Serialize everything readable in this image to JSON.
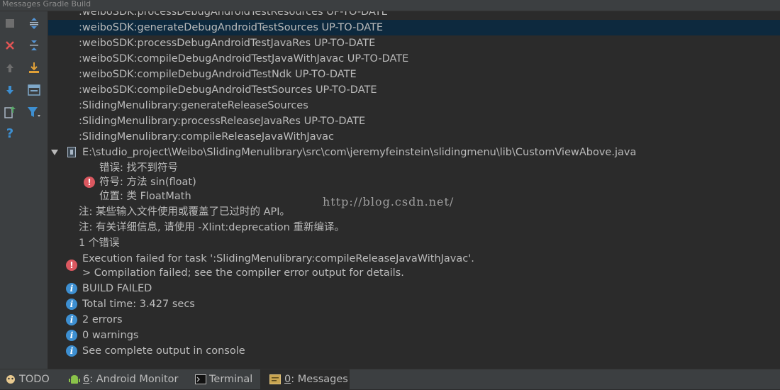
{
  "window": {
    "title": "Messages Gradle Build"
  },
  "toolbar": {
    "buttons": [
      {
        "name": "stop-icon"
      },
      {
        "name": "expand-all-icon"
      },
      {
        "name": "close-icon"
      },
      {
        "name": "collapse-all-icon"
      },
      {
        "name": "previous-icon"
      },
      {
        "name": "export-icon"
      },
      {
        "name": "next-icon"
      },
      {
        "name": "autoscroll-icon"
      },
      {
        "name": "export-to-text-icon"
      },
      {
        "name": "filter-icon"
      },
      {
        "name": "help-icon"
      }
    ]
  },
  "messages": {
    "lines": [
      ":weiboSDK:processDebugAndroidTestResources UP-TO-DATE",
      ":weiboSDK:generateDebugAndroidTestSources UP-TO-DATE",
      ":weiboSDK:processDebugAndroidTestJavaRes UP-TO-DATE",
      ":weiboSDK:compileDebugAndroidTestJavaWithJavac UP-TO-DATE",
      ":weiboSDK:compileDebugAndroidTestNdk UP-TO-DATE",
      ":weiboSDK:compileDebugAndroidTestSources UP-TO-DATE",
      ":SlidingMenulibrary:generateReleaseSources",
      ":SlidingMenulibrary:processReleaseJavaRes UP-TO-DATE",
      ":SlidingMenulibrary:compileReleaseJavaWithJavac"
    ],
    "file_path": "E:\\studio_project\\Weibo\\SlidingMenulibrary\\src\\com\\jeremyfeinstein\\slidingmenu\\lib\\CustomViewAbove.java",
    "error_detail": {
      "line1": "错误: 找不到符号",
      "line2": "符号:   方法 sin(float)",
      "line3": "位置: 类 FloatMath"
    },
    "notes": [
      "注: 某些输入文件使用或覆盖了已过时的 API。",
      "注: 有关详细信息, 请使用 -Xlint:deprecation 重新编译。",
      "1 个错误"
    ],
    "failure": {
      "line1": "Execution failed for task ':SlidingMenulibrary:compileReleaseJavaWithJavac'.",
      "line2": "> Compilation failed; see the compiler error output for details."
    },
    "summary": [
      "BUILD FAILED",
      "Total time: 3.427 secs",
      "2 errors",
      "0 warnings",
      "See complete output in console"
    ]
  },
  "watermark": "http://blog.csdn.net/",
  "bottom_tabs": {
    "todo": "TODO",
    "android_monitor_key": "6",
    "android_monitor": ": Android Monitor",
    "terminal": "Terminal",
    "messages_key": "0",
    "messages": ": Messages"
  },
  "colors": {
    "background": "#2b2b2b",
    "panel": "#3c3f41",
    "selection": "#0d293e",
    "error": "#db5860",
    "info": "#3d8fd1",
    "text": "#bbbbbb"
  }
}
